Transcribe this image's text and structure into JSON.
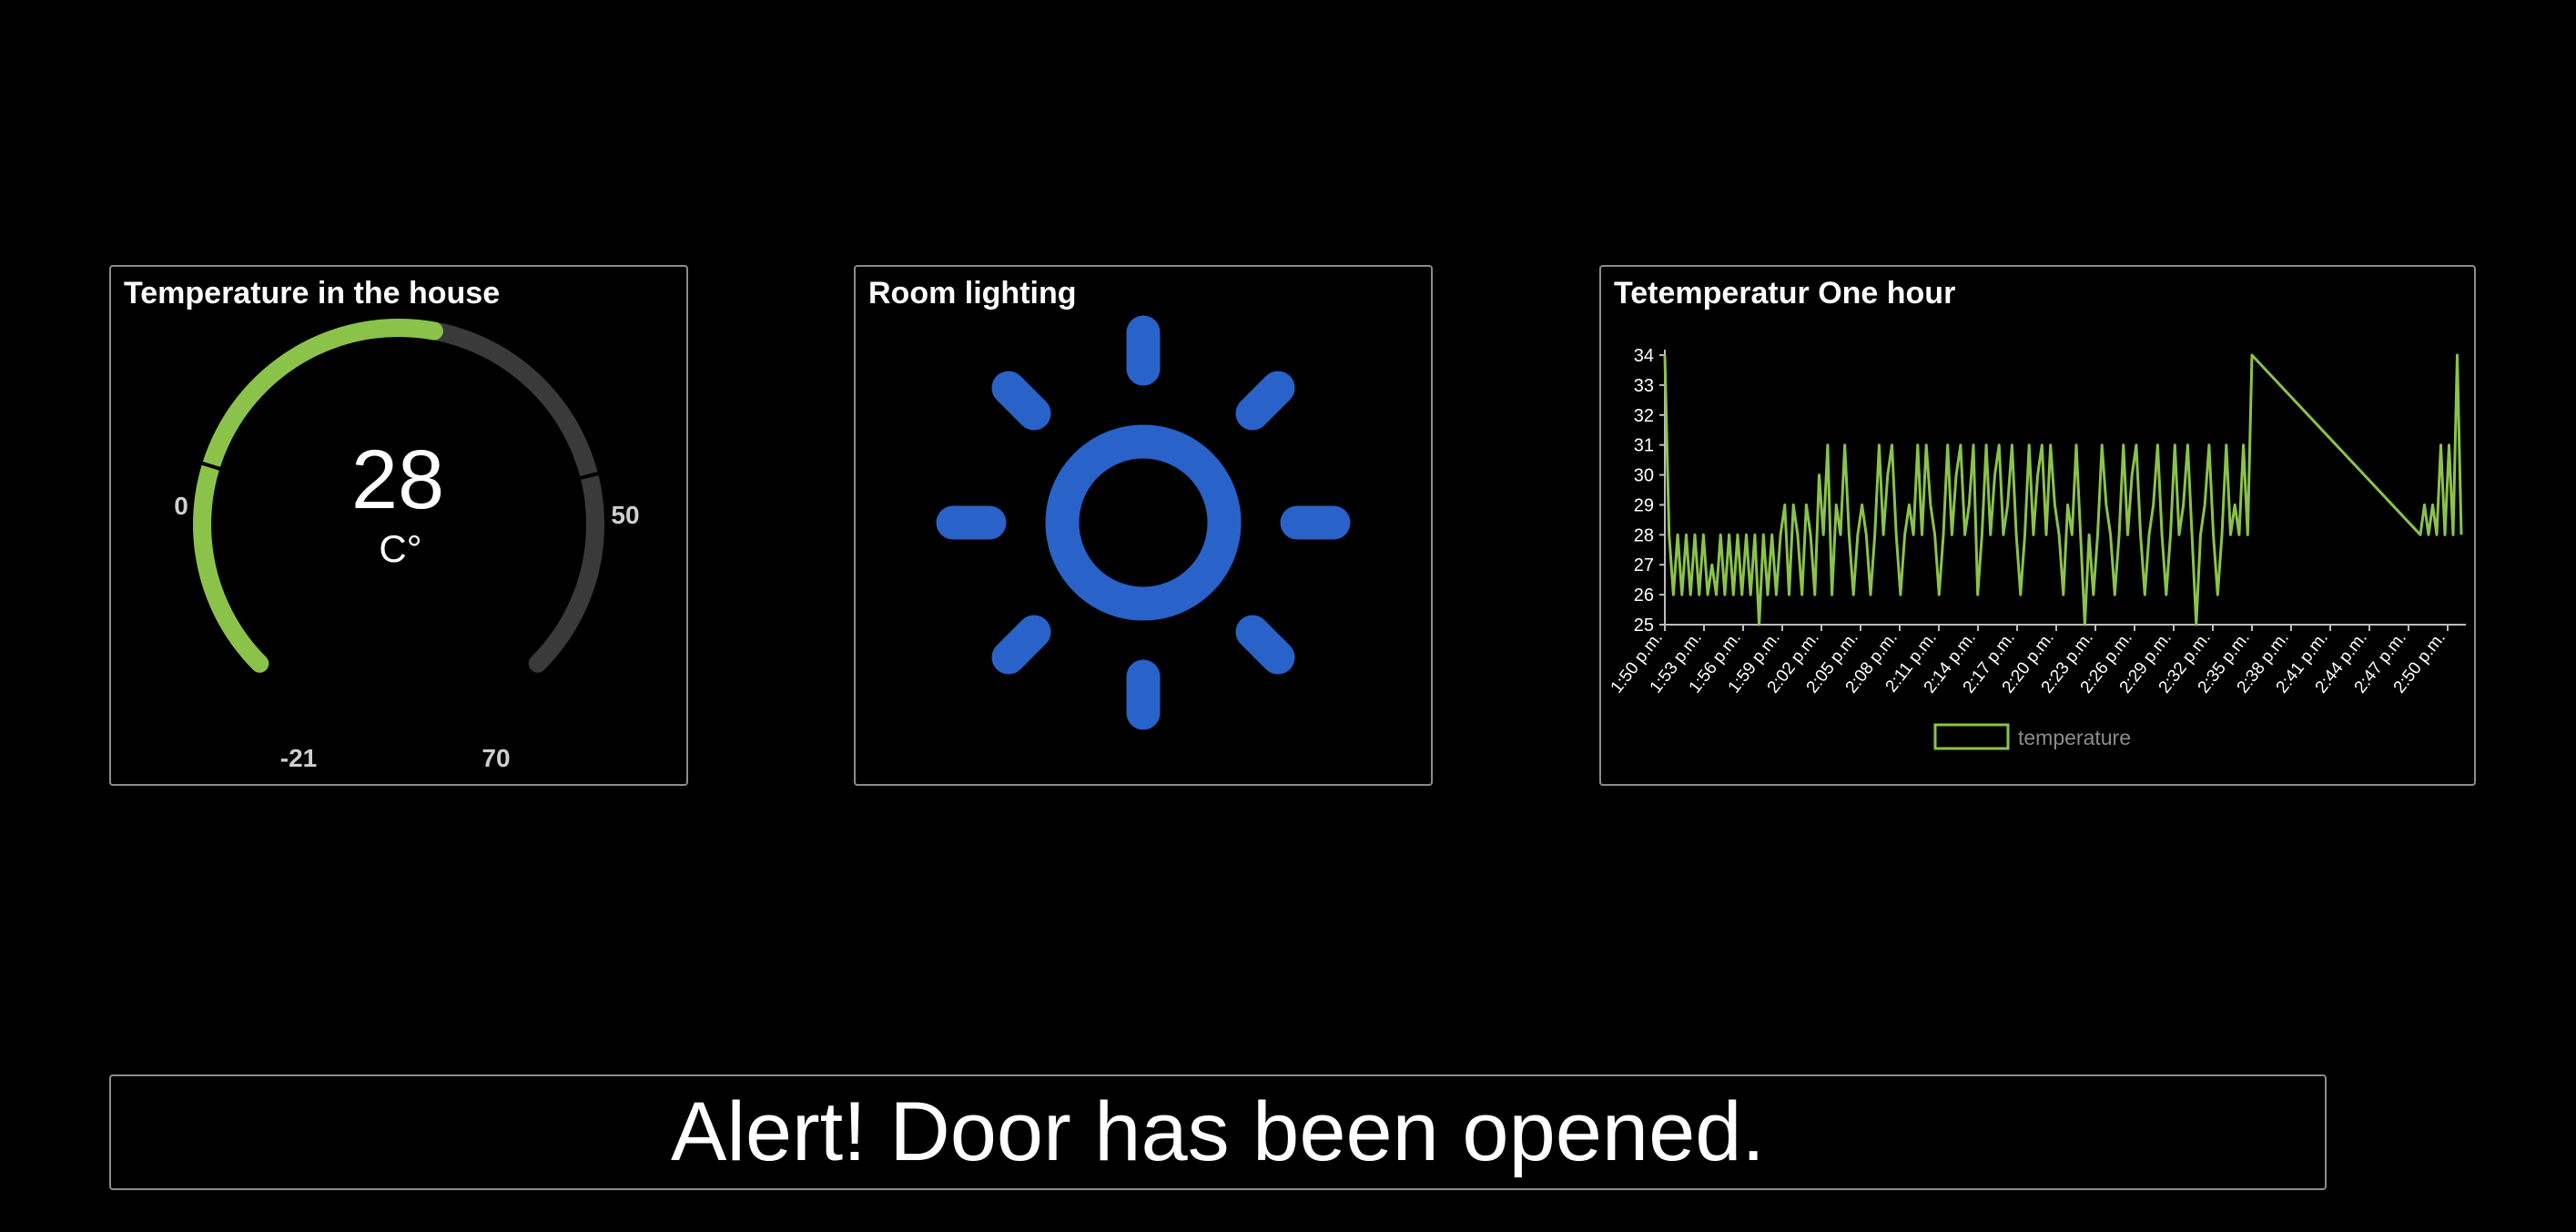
{
  "colors": {
    "background": "#000000",
    "panel_border": "#8c8c8c",
    "gauge_fill": "#8bc34a",
    "gauge_track": "#3a3a3a",
    "light_icon": "#2962c8",
    "series_line": "#8bc34a"
  },
  "gauge": {
    "title": "Temperature in the house",
    "value": "28",
    "unit": "C°",
    "min_label": "-21",
    "max_label": "70",
    "threshold_low_label": "0",
    "threshold_high_label": "50",
    "value_numeric": 28,
    "min": -21,
    "max": 70
  },
  "lighting": {
    "title": "Room lighting",
    "icon": "sun-icon"
  },
  "chart": {
    "title": "Tetemperatur One hour"
  },
  "chart_data": {
    "type": "line",
    "title": "Tetemperatur One hour",
    "xlabel": "",
    "ylabel": "",
    "ylim": [
      25,
      34
    ],
    "y_ticks": [
      "25",
      "26",
      "27",
      "28",
      "29",
      "30",
      "31",
      "32",
      "33",
      "34"
    ],
    "x_ticks": [
      "1:50 p.m.",
      "1:53 p.m.",
      "1:56 p.m.",
      "1:59 p.m.",
      "2:02 p.m.",
      "2:05 p.m.",
      "2:08 p.m.",
      "2:11 p.m.",
      "2:14 p.m.",
      "2:17 p.m.",
      "2:20 p.m.",
      "2:23 p.m.",
      "2:26 p.m.",
      "2:29 p.m.",
      "2:32 p.m.",
      "2:35 p.m.",
      "2:38 p.m.",
      "2:41 p.m.",
      "2:44 p.m.",
      "2:47 p.m.",
      "2:50 p.m."
    ],
    "legend": "bottom",
    "series": [
      {
        "name": "temperature",
        "values": [
          34,
          28,
          26,
          28,
          26,
          28,
          26,
          28,
          26,
          28,
          26,
          27,
          26,
          28,
          26,
          28,
          26,
          28,
          26,
          28,
          26,
          28,
          25,
          28,
          26,
          28,
          26,
          28,
          29,
          26,
          29,
          28,
          26,
          29,
          28,
          26,
          30,
          28,
          31,
          26,
          29,
          28,
          31,
          28,
          26,
          28,
          29,
          28,
          26,
          28,
          31,
          28,
          30,
          31,
          28,
          26,
          28,
          29,
          28,
          31,
          28,
          31,
          29,
          28,
          26,
          28,
          31,
          28,
          30,
          31,
          28,
          29,
          31,
          26,
          28,
          31,
          28,
          30,
          31,
          28,
          29,
          31,
          28,
          26,
          28,
          31,
          28,
          30,
          31,
          28,
          31,
          29,
          28,
          26,
          29,
          28,
          31,
          28,
          25,
          28,
          26,
          28,
          31,
          29,
          28,
          26,
          28,
          31,
          28,
          30,
          31,
          28,
          26,
          28,
          29,
          31,
          28,
          26,
          28,
          31,
          28,
          29,
          31,
          28,
          25,
          28,
          29,
          31,
          28,
          26,
          28,
          31,
          28,
          29,
          28,
          31,
          28,
          34,
          28,
          29,
          28,
          29,
          28,
          31,
          28,
          31,
          28,
          34,
          28
        ]
      }
    ]
  },
  "alert": {
    "text": "Alert! Door has been opened."
  }
}
